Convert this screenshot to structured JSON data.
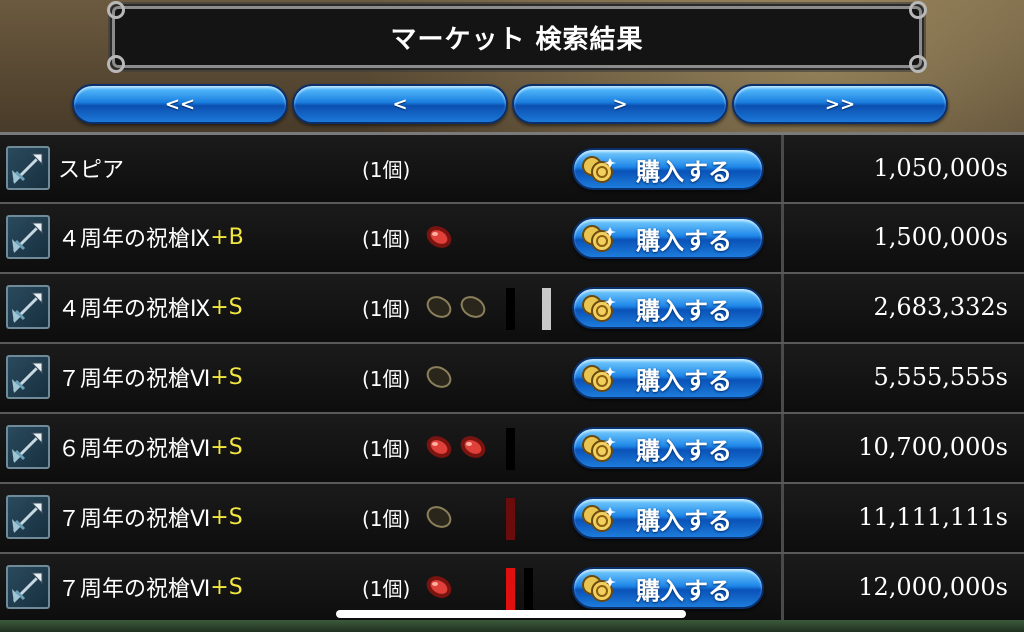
{
  "header": {
    "title": "マーケット 検索結果"
  },
  "nav": {
    "first": "<<",
    "prev": "<",
    "next": ">",
    "last": ">>"
  },
  "buy_label": "購入する",
  "icons": {
    "item": "spear-icon",
    "coin": "coin-icon",
    "gem_red": "red-gem-icon",
    "gem_empty": "empty-gem-slot-icon"
  },
  "colors": {
    "grade_text": "#f2e640",
    "button_blue": "#1e86e8",
    "gem_red": "#d8302a",
    "bar_black": "#000000",
    "bar_gray": "#c8c8c8",
    "bar_darkred": "#6a0c0c",
    "bar_red": "#e01010"
  },
  "rows": [
    {
      "name": "スピア",
      "grade": "",
      "qty": "(1個)",
      "gems": [],
      "bars": [],
      "price": "1,050,000s"
    },
    {
      "name": "４周年の祝槍Ⅸ",
      "grade": "+B",
      "qty": "(1個)",
      "gems": [
        "red"
      ],
      "bars": [],
      "price": "1,500,000s"
    },
    {
      "name": "４周年の祝槍Ⅸ",
      "grade": "+S",
      "qty": "(1個)",
      "gems": [
        "empty",
        "empty"
      ],
      "bars": [
        "black",
        "gap",
        "gap",
        "gap",
        "gray"
      ],
      "price": "2,683,332s"
    },
    {
      "name": "７周年の祝槍Ⅵ",
      "grade": "+S",
      "qty": "(1個)",
      "gems": [
        "empty"
      ],
      "bars": [],
      "price": "5,555,555s"
    },
    {
      "name": "６周年の祝槍Ⅵ",
      "grade": "+S",
      "qty": "(1個)",
      "gems": [
        "red",
        "red"
      ],
      "bars": [
        "black"
      ],
      "price": "10,700,000s"
    },
    {
      "name": "７周年の祝槍Ⅵ",
      "grade": "+S",
      "qty": "(1個)",
      "gems": [
        "empty"
      ],
      "bars": [
        "darkred"
      ],
      "price": "11,111,111s"
    },
    {
      "name": "７周年の祝槍Ⅵ",
      "grade": "+S",
      "qty": "(1個)",
      "gems": [
        "red"
      ],
      "bars": [
        "red",
        "gap",
        "black"
      ],
      "price": "12,000,000s"
    }
  ]
}
